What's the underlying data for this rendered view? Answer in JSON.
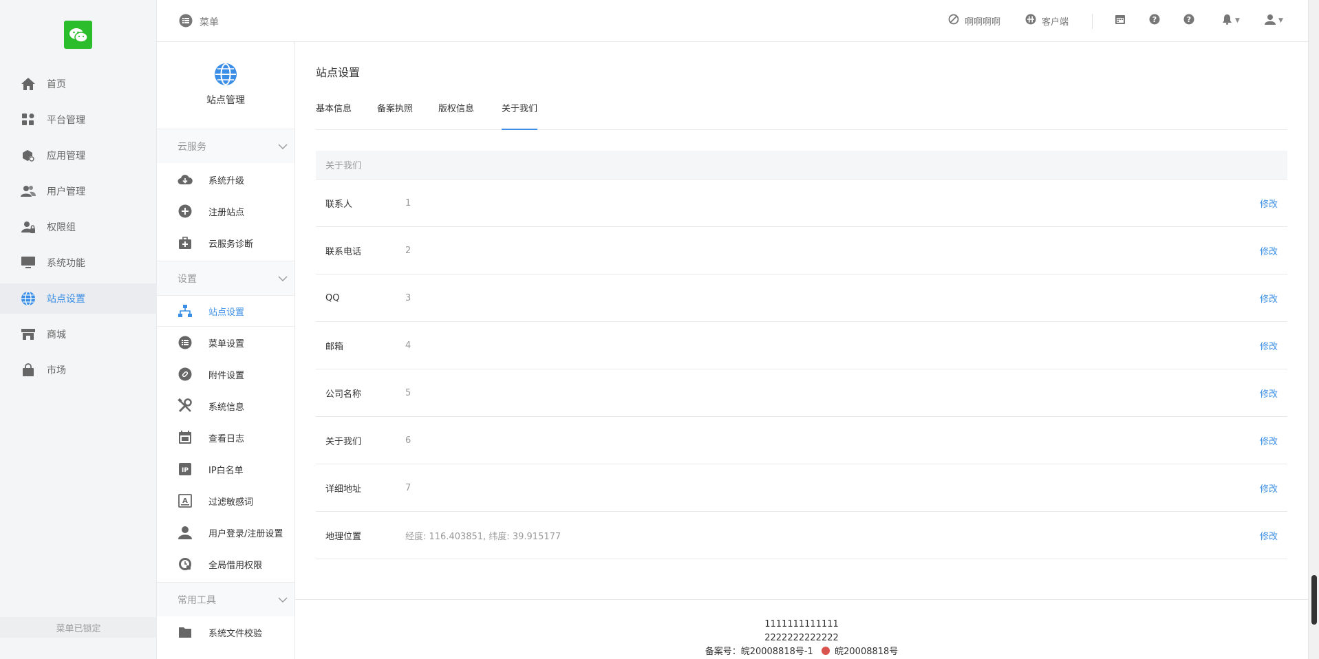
{
  "main_nav": {
    "items": [
      {
        "label": "首页",
        "icon": "home-icon"
      },
      {
        "label": "平台管理",
        "icon": "apps-icon"
      },
      {
        "label": "应用管理",
        "icon": "box-gear-icon"
      },
      {
        "label": "用户管理",
        "icon": "users-icon"
      },
      {
        "label": "权限组",
        "icon": "user-lock-icon"
      },
      {
        "label": "系统功能",
        "icon": "monitor-icon"
      },
      {
        "label": "站点设置",
        "icon": "globe-icon",
        "active": true
      },
      {
        "label": "商城",
        "icon": "store-icon"
      },
      {
        "label": "市场",
        "icon": "bag-icon"
      }
    ],
    "lock_text": "菜单已锁定"
  },
  "header": {
    "menu_label": "菜单",
    "link1": "啊啊啊啊",
    "link2": "客户端"
  },
  "sub_nav": {
    "title": "站点管理",
    "groups": [
      {
        "title": "云服务",
        "items": [
          "系统升级",
          "注册站点",
          "云服务诊断"
        ]
      },
      {
        "title": "设置",
        "items": [
          "站点设置",
          "菜单设置",
          "附件设置",
          "系统信息",
          "查看日志",
          "IP白名单",
          "过滤敏感词",
          "用户登录/注册设置",
          "全局借用权限"
        ]
      },
      {
        "title": "常用工具",
        "items": [
          "系统文件校验"
        ]
      }
    ],
    "ip_badge": "IP"
  },
  "content": {
    "page_title": "站点设置",
    "tabs": [
      "基本信息",
      "备案执照",
      "版权信息",
      "关于我们"
    ],
    "active_tab": "关于我们",
    "table_header": "关于我们",
    "edit_label": "修改",
    "rows": [
      {
        "label": "联系人",
        "value": "1"
      },
      {
        "label": "联系电话",
        "value": "2"
      },
      {
        "label": "QQ",
        "value": "3"
      },
      {
        "label": "邮箱",
        "value": "4"
      },
      {
        "label": "公司名称",
        "value": "5"
      },
      {
        "label": "关于我们",
        "value": "6"
      },
      {
        "label": "详细地址",
        "value": "7"
      },
      {
        "label": "地理位置",
        "value": "经度: 116.403851, 纬度: 39.915177"
      }
    ]
  },
  "footer": {
    "line1": "1111111111111",
    "line2": "2222222222222",
    "icp": "备案号：皖20008818号-1",
    "police": "皖20008818号"
  },
  "colors": {
    "accent": "#3a8ee6",
    "logo": "#2bbd2b"
  }
}
